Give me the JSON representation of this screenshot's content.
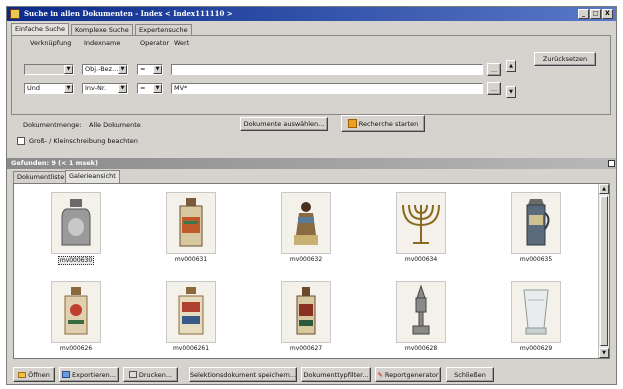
{
  "window": {
    "title": "Suche in allen Dokumenten - Index < Index111110 >",
    "btn_min": "_",
    "btn_max": "□",
    "btn_close": "X"
  },
  "tabs_top": [
    "Einfache Suche",
    "Komplexe Suche",
    "Expertensuche"
  ],
  "headers": {
    "link": "Verknüpfung",
    "index": "Indexname",
    "op": "Operator",
    "value": "Wert"
  },
  "rows": [
    {
      "link": "",
      "index": "Obj.-Bez...",
      "op": "=",
      "value": ""
    },
    {
      "link": "Und",
      "index": "Inv-Nr.",
      "op": "=",
      "value": "MV*"
    }
  ],
  "dots": "...",
  "reset_label": "Zurücksetzen",
  "dokmenge_label": "Dokumentmenge:",
  "dokmenge_value": "Alle Dokumente",
  "select_docs_label": "Dokumente auswählen...",
  "start_search_label": "Recherche starten",
  "case_label": "Groß- / Kleinschreibung beachten",
  "found_label": "Gefunden: 9 (< 1 msek)",
  "tabs_result": [
    "Dokumentliste",
    "Galerieansicht"
  ],
  "gallery": [
    {
      "caption": "mv000630",
      "icon": "bottle-icon",
      "selected": true
    },
    {
      "caption": "mv000631",
      "icon": "jar-icon",
      "selected": false
    },
    {
      "caption": "mv000632",
      "icon": "figurine-icon",
      "selected": false
    },
    {
      "caption": "mv000634",
      "icon": "menorah-icon",
      "selected": false
    },
    {
      "caption": "mv000635",
      "icon": "stein-icon",
      "selected": false
    },
    {
      "caption": "mv000626",
      "icon": "painted-bottle-icon",
      "selected": false
    },
    {
      "caption": "mv0006261",
      "icon": "painted-flask-icon",
      "selected": false
    },
    {
      "caption": "mv000627",
      "icon": "painted-vase-icon",
      "selected": false
    },
    {
      "caption": "mv000628",
      "icon": "spice-tower-icon",
      "selected": false
    },
    {
      "caption": "mv000629",
      "icon": "glass-beaker-icon",
      "selected": false
    }
  ],
  "bottom": {
    "open": "Öffnen",
    "export": "Exportieren...",
    "print": "Drucken...",
    "save_selection": "Selektionsdokument speichern...",
    "doctype_filter": "Dokumenttypfilter...",
    "report": "Reportgenerator",
    "close": "Schließen"
  },
  "colors": {
    "title_start": "#0a2a8a",
    "title_end": "#5a78c8",
    "window_bg": "#d6d3ce",
    "search_icon": "#f0a020"
  }
}
